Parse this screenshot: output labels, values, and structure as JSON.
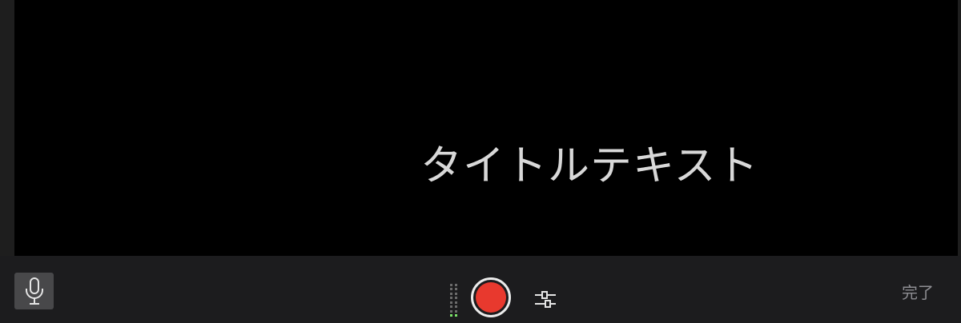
{
  "preview": {
    "title_text": "タイトルテキスト"
  },
  "toolbar": {
    "mic_icon": "microphone-icon",
    "record_icon": "record-icon",
    "settings_icon": "sliders-icon",
    "done_label": "完了",
    "input_level": 0.1
  },
  "colors": {
    "record_red": "#e8392e",
    "level_green": "#7be36a",
    "toolbar_bg": "#1c1c1e",
    "preview_bg": "#000000",
    "title_text": "#d8d8d8",
    "done_text": "#8e8e93"
  }
}
